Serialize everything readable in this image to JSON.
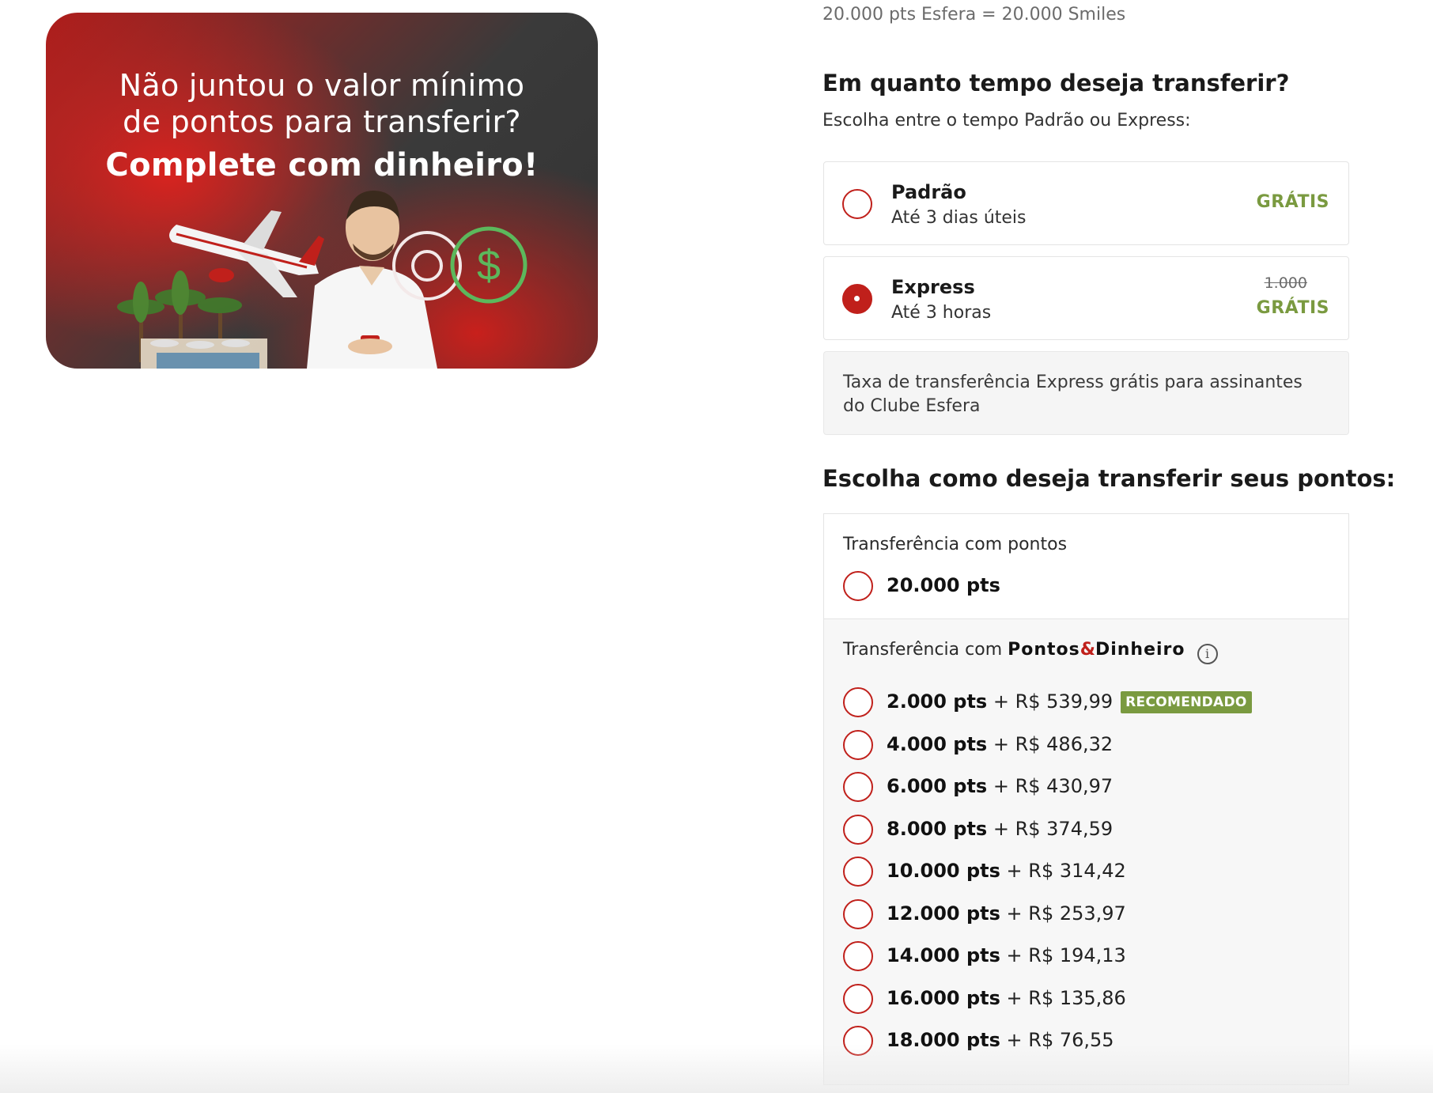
{
  "banner": {
    "line1": "Não juntou o valor mínimo",
    "line2": "de pontos para transferir?",
    "line3": "Complete com dinheiro!",
    "colors": {
      "red": "#d8231f",
      "dark": "#333333",
      "green": "#5cb85c"
    },
    "icons": [
      "airplane-icon",
      "coin-outline-icon",
      "dollar-coin-icon"
    ]
  },
  "conversion": "20.000 pts Esfera = 20.000 Smiles",
  "time_section": {
    "title": "Em quanto tempo deseja transferir?",
    "subtitle": "Escolha entre o tempo Padrão ou Express:",
    "options": [
      {
        "title": "Padrão",
        "sub": "Até 3 dias úteis",
        "price": "GRÁTIS",
        "old_price": "",
        "selected": false
      },
      {
        "title": "Express",
        "sub": "Até 3 horas",
        "price": "GRÁTIS",
        "old_price": "1.000",
        "selected": true
      }
    ],
    "note": "Taxa de transferência Express grátis para assinantes do Clube Esfera"
  },
  "transfer_section": {
    "title": "Escolha como deseja transferir seus pontos:",
    "points_label": "Transferência com pontos",
    "points_option": "20.000 pts",
    "mix_label_prefix": "Transferência com",
    "mix_brand_a": "Pontos",
    "mix_brand_amp": "&",
    "mix_brand_b": "Dinheiro",
    "info_icon": "i",
    "recommended_badge": "RECOMENDADO",
    "options": [
      {
        "pts": "2.000 pts",
        "money": " + R$ 539,99"
      },
      {
        "pts": "4.000 pts",
        "money": " + R$ 486,32"
      },
      {
        "pts": "6.000 pts",
        "money": " + R$ 430,97"
      },
      {
        "pts": "8.000 pts",
        "money": " + R$ 374,59"
      },
      {
        "pts": "10.000 pts",
        "money": " + R$ 314,42"
      },
      {
        "pts": "12.000 pts",
        "money": " + R$ 253,97"
      },
      {
        "pts": "14.000 pts",
        "money": " + R$ 194,13"
      },
      {
        "pts": "16.000 pts",
        "money": " + R$ 135,86"
      },
      {
        "pts": "18.000 pts",
        "money": " + R$ 76,55"
      }
    ]
  },
  "theme": {
    "accent_red": "#c0201b",
    "accent_green": "#7a9a40"
  }
}
